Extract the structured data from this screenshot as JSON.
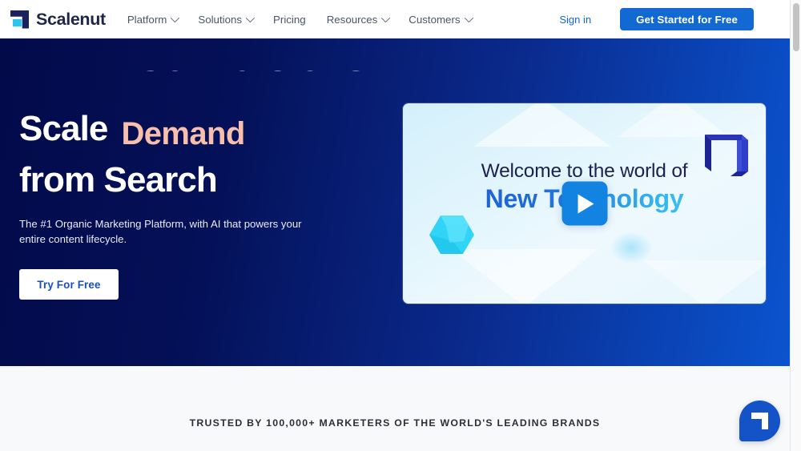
{
  "nav": {
    "brand_name": "Scalenut",
    "logo_icon": "scalenut-logo-icon",
    "items": [
      {
        "label": "Platform",
        "has_dropdown": true
      },
      {
        "label": "Solutions",
        "has_dropdown": true
      },
      {
        "label": "Pricing",
        "has_dropdown": false
      },
      {
        "label": "Resources",
        "has_dropdown": true
      },
      {
        "label": "Customers",
        "has_dropdown": true
      }
    ],
    "signin_label": "Sign in",
    "cta_label": "Get Started for Free",
    "cta_color": "#1269d3"
  },
  "hero": {
    "rotator_previous_word": "Conversions",
    "headline_line1_static": "Scale",
    "headline_line1_accent": "Demand",
    "headline_line2": "from Search",
    "accent_color": "#f7bfac",
    "subtext": "The #1 Organic Marketing Platform, with AI that powers your entire content lifecycle.",
    "cta_label": "Try For Free",
    "gradient_from": "#030a4a",
    "gradient_to": "#0b54cf"
  },
  "video": {
    "line1": "Welcome to the world of",
    "line2": "New Technology",
    "play_icon": "play-icon",
    "logo_3d_icon": "scalenut-3d-logo-icon",
    "crystal_icon": "cyan-crystal-icon"
  },
  "trusted": {
    "text": "TRUSTED BY 100,000+ MARKETERS OF THE WORLD'S LEADING BRANDS"
  },
  "chat": {
    "icon": "scalenut-chat-bubble-icon"
  },
  "scrollbar": {
    "thumb_position": "top"
  }
}
